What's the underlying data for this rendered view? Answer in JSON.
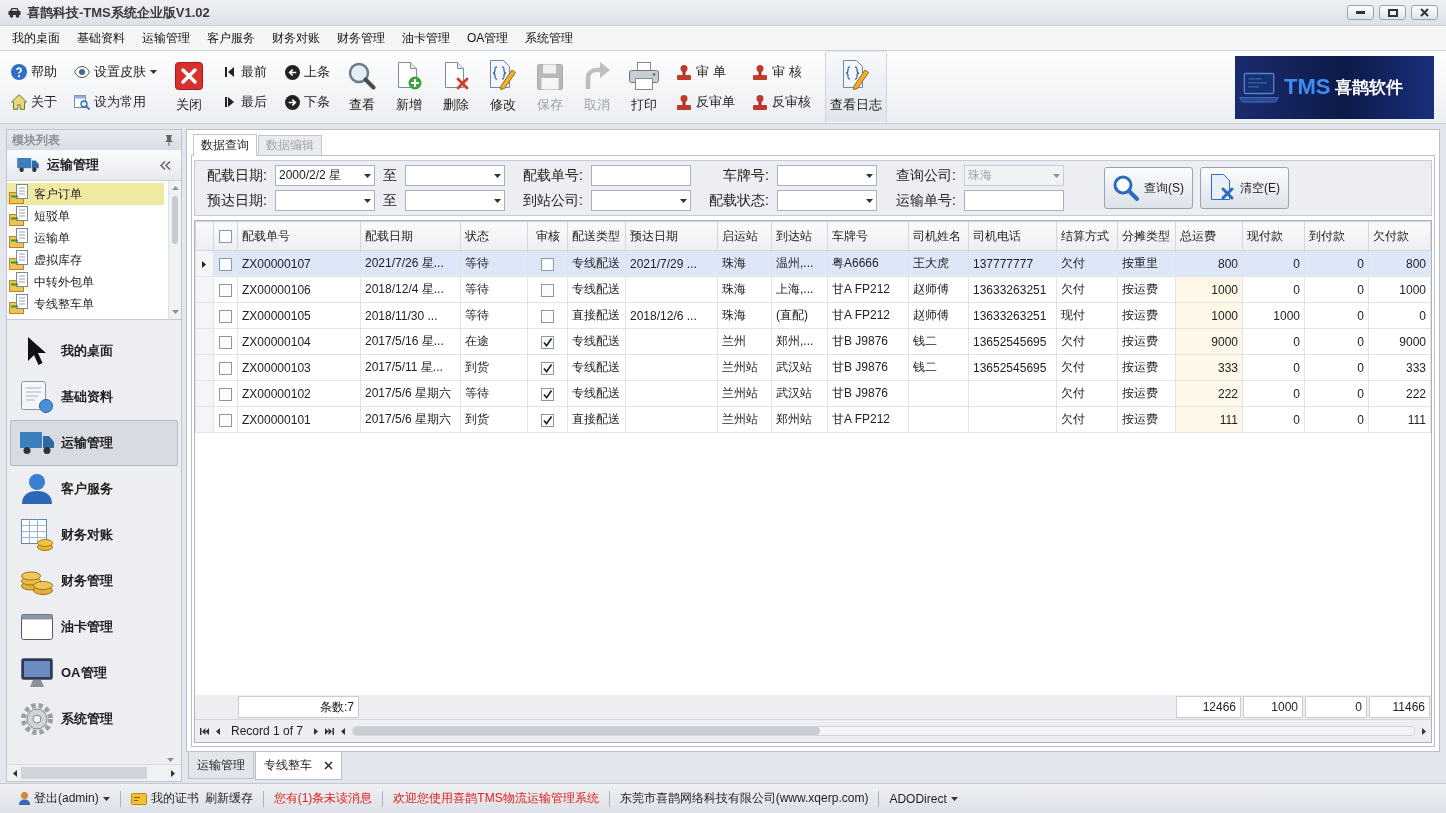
{
  "window": {
    "title": "喜鹊科技-TMS系统企业版V1.02"
  },
  "menu": [
    "我的桌面",
    "基础资料",
    "运输管理",
    "客户服务",
    "财务对账",
    "财务管理",
    "油卡管理",
    "OA管理",
    "系统管理"
  ],
  "toolbar": [
    {
      "kind": "stack",
      "items": [
        {
          "label": "帮助",
          "disabled": false,
          "menu": false,
          "highlighted": false
        },
        {
          "label": "关于",
          "disabled": false,
          "menu": false,
          "highlighted": false
        }
      ]
    },
    {
      "kind": "stack",
      "items": [
        {
          "label": "设置皮肤",
          "disabled": false,
          "menu": true,
          "highlighted": false
        },
        {
          "label": "设为常用",
          "disabled": false,
          "menu": false,
          "highlighted": false
        }
      ]
    },
    {
      "kind": "large",
      "items": [
        {
          "label": "关闭",
          "disabled": false,
          "menu": false,
          "highlighted": false
        }
      ]
    },
    {
      "kind": "stack",
      "items": [
        {
          "label": "最前",
          "disabled": false,
          "menu": false,
          "highlighted": false
        },
        {
          "label": "最后",
          "disabled": false,
          "menu": false,
          "highlighted": false
        }
      ]
    },
    {
      "kind": "stack",
      "items": [
        {
          "label": "上条",
          "disabled": false,
          "menu": false,
          "highlighted": false
        },
        {
          "label": "下条",
          "disabled": false,
          "menu": false,
          "highlighted": false
        }
      ]
    },
    {
      "kind": "large",
      "items": [
        {
          "label": "查看",
          "disabled": false,
          "menu": false,
          "highlighted": false
        }
      ]
    },
    {
      "kind": "large",
      "items": [
        {
          "label": "新增",
          "disabled": false,
          "menu": false,
          "highlighted": false
        }
      ]
    },
    {
      "kind": "large",
      "items": [
        {
          "label": "删除",
          "disabled": false,
          "menu": false,
          "highlighted": false
        }
      ]
    },
    {
      "kind": "large",
      "items": [
        {
          "label": "修改",
          "disabled": false,
          "menu": false,
          "highlighted": false
        }
      ]
    },
    {
      "kind": "large",
      "items": [
        {
          "label": "保存",
          "disabled": true,
          "menu": false,
          "highlighted": false
        }
      ]
    },
    {
      "kind": "large",
      "items": [
        {
          "label": "取消",
          "disabled": true,
          "menu": false,
          "highlighted": false
        }
      ]
    },
    {
      "kind": "large",
      "items": [
        {
          "label": "打印",
          "disabled": false,
          "menu": false,
          "highlighted": false
        }
      ]
    },
    {
      "kind": "stack",
      "items": [
        {
          "label": "审 单",
          "disabled": false,
          "menu": false,
          "highlighted": false
        },
        {
          "label": "反审单",
          "disabled": false,
          "menu": false,
          "highlighted": false
        }
      ]
    },
    {
      "kind": "stack",
      "items": [
        {
          "label": "审 核",
          "disabled": false,
          "menu": false,
          "highlighted": false
        },
        {
          "label": "反审核",
          "disabled": false,
          "menu": false,
          "highlighted": false
        }
      ]
    },
    {
      "kind": "large",
      "items": [
        {
          "label": "查看日志",
          "disabled": false,
          "menu": false,
          "highlighted": true
        }
      ]
    }
  ],
  "brand": {
    "mark": "TMS",
    "name": "喜鹊软件"
  },
  "sidebar": {
    "title": "模块列表",
    "group": "运输管理",
    "items": [
      {
        "label": "客户订单",
        "selected": true
      },
      {
        "label": "短驳单",
        "selected": false
      },
      {
        "label": "运输单",
        "selected": false
      },
      {
        "label": "虚拟库存",
        "selected": false
      },
      {
        "label": "中转外包单",
        "selected": false
      },
      {
        "label": "专线整车单",
        "selected": false
      }
    ],
    "modules": [
      {
        "label": "我的桌面",
        "selected": false
      },
      {
        "label": "基础资料",
        "selected": false
      },
      {
        "label": "运输管理",
        "selected": true
      },
      {
        "label": "客户服务",
        "selected": false
      },
      {
        "label": "财务对账",
        "selected": false
      },
      {
        "label": "财务管理",
        "selected": false
      },
      {
        "label": "油卡管理",
        "selected": false
      },
      {
        "label": "OA管理",
        "selected": false
      },
      {
        "label": "系统管理",
        "selected": false
      }
    ]
  },
  "tabs": [
    {
      "label": "数据查询",
      "selected": true,
      "disabled": false
    },
    {
      "label": "数据编辑",
      "selected": false,
      "disabled": true
    }
  ],
  "filters": [
    {
      "label": "配载日期:",
      "kind": "dropdown",
      "value": "2000/2/2 星",
      "disabled": false
    },
    {
      "label": "至",
      "kind": "dropdown",
      "disabled": false
    },
    {
      "label": "配载单号:",
      "kind": "text",
      "disabled": false
    },
    {
      "label": "车牌号:",
      "kind": "dropdown",
      "disabled": false
    },
    {
      "label": "查询公司:",
      "kind": "dropdown",
      "value": "珠海",
      "disabled": true
    },
    {
      "label": "预达日期:",
      "kind": "dropdown",
      "disabled": false
    },
    {
      "label": "至",
      "kind": "dropdown",
      "disabled": false
    },
    {
      "label": "到站公司:",
      "kind": "dropdown",
      "disabled": false
    },
    {
      "label": "配载状态:",
      "kind": "dropdown",
      "disabled": false
    },
    {
      "label": "运输单号:",
      "kind": "text",
      "disabled": false
    }
  ],
  "filter_buttons": [
    {
      "label": "查询(S)"
    },
    {
      "label": "清空(E)"
    }
  ],
  "table": {
    "select_all": {
      "checked": false
    },
    "columns": [
      {
        "label": "配载单号",
        "kind": "text"
      },
      {
        "label": "配载日期",
        "kind": "text"
      },
      {
        "label": "状态",
        "kind": "text"
      },
      {
        "label": "审核",
        "kind": "check"
      },
      {
        "label": "配送类型",
        "kind": "text"
      },
      {
        "label": "预达日期",
        "kind": "text"
      },
      {
        "label": "启运站",
        "kind": "text"
      },
      {
        "label": "到达站",
        "kind": "text"
      },
      {
        "label": "车牌号",
        "kind": "text"
      },
      {
        "label": "司机姓名",
        "kind": "text"
      },
      {
        "label": "司机电话",
        "kind": "text"
      },
      {
        "label": "结算方式",
        "kind": "text"
      },
      {
        "label": "分摊类型",
        "kind": "text"
      },
      {
        "label": "总运费",
        "kind": "total"
      },
      {
        "label": "现付款",
        "kind": "number"
      },
      {
        "label": "到付款",
        "kind": "number"
      },
      {
        "label": "欠付款",
        "kind": "number"
      }
    ],
    "rows": [
      {
        "selected": true,
        "checked": false,
        "cells": [
          "ZX00000107",
          "2021/7/26 星...",
          "等待",
          false,
          "专线配送",
          "2021/7/29 ...",
          "珠海",
          "温州,...",
          "粤A6666",
          "王大虎",
          "137777777",
          "欠付",
          "按重里",
          "800",
          "0",
          "0",
          "800"
        ]
      },
      {
        "selected": false,
        "checked": false,
        "cells": [
          "ZX00000106",
          "2018/12/4 星...",
          "等待",
          false,
          "专线配送",
          null,
          "珠海",
          "上海,...",
          "甘A FP212",
          "赵师傅",
          "13633263251",
          "欠付",
          "按运费",
          "1000",
          "0",
          "0",
          "1000"
        ]
      },
      {
        "selected": false,
        "checked": false,
        "cells": [
          "ZX00000105",
          "2018/11/30 ...",
          "等待",
          false,
          "直接配送",
          "2018/12/6 ...",
          "珠海",
          "(直配)",
          "甘A FP212",
          "赵师傅",
          "13633263251",
          "现付",
          "按运费",
          "1000",
          "1000",
          "0",
          "0"
        ]
      },
      {
        "selected": false,
        "checked": false,
        "cells": [
          "ZX00000104",
          "2017/5/16 星...",
          "在途",
          true,
          "专线配送",
          null,
          "兰州",
          "郑州,...",
          "甘B J9876",
          "钱二",
          "13652545695",
          "欠付",
          "按运费",
          "9000",
          "0",
          "0",
          "9000"
        ]
      },
      {
        "selected": false,
        "checked": false,
        "cells": [
          "ZX00000103",
          "2017/5/11 星...",
          "到货",
          true,
          "专线配送",
          null,
          "兰州站",
          "武汉站",
          "甘B J9876",
          "钱二",
          "13652545695",
          "欠付",
          "按运费",
          "333",
          "0",
          "0",
          "333"
        ]
      },
      {
        "selected": false,
        "checked": false,
        "cells": [
          "ZX00000102",
          "2017/5/6 星期六",
          "等待",
          true,
          "专线配送",
          null,
          "兰州站",
          "武汉站",
          "甘B J9876",
          null,
          null,
          "欠付",
          "按运费",
          "222",
          "0",
          "0",
          "222"
        ]
      },
      {
        "selected": false,
        "checked": false,
        "cells": [
          "ZX00000101",
          "2017/5/6 星期六",
          "到货",
          true,
          "直接配送",
          null,
          "兰州站",
          "郑州站",
          "甘A FP212",
          null,
          null,
          "欠付",
          "按运费",
          "111",
          "0",
          "0",
          "111"
        ]
      }
    ],
    "footer": {
      "count": "条数:7",
      "totals": [
        "12466",
        "1000",
        "0",
        "11466"
      ]
    },
    "navigator": "Record 1 of 7"
  },
  "document_tabs": [
    {
      "label": "运输管理",
      "selected": false,
      "closable": false
    },
    {
      "label": "专线整车",
      "selected": true,
      "closable": true
    }
  ],
  "status_bar": [
    {
      "label": "登出(admin)",
      "kind": "dropdown"
    },
    {
      "label": "我的证书",
      "kind": "button"
    },
    {
      "label": "刷新缓存",
      "kind": "button"
    },
    {
      "label": "您有(1)条未读消息",
      "kind": "alert"
    },
    {
      "label": "欢迎您使用喜鹊TMS物流运输管理系统",
      "kind": "alert"
    },
    {
      "label": "东莞市喜鹊网络科技有限公司(www.xqerp.com)",
      "kind": "text"
    },
    {
      "label": "ADODirect",
      "kind": "dropdown"
    }
  ]
}
